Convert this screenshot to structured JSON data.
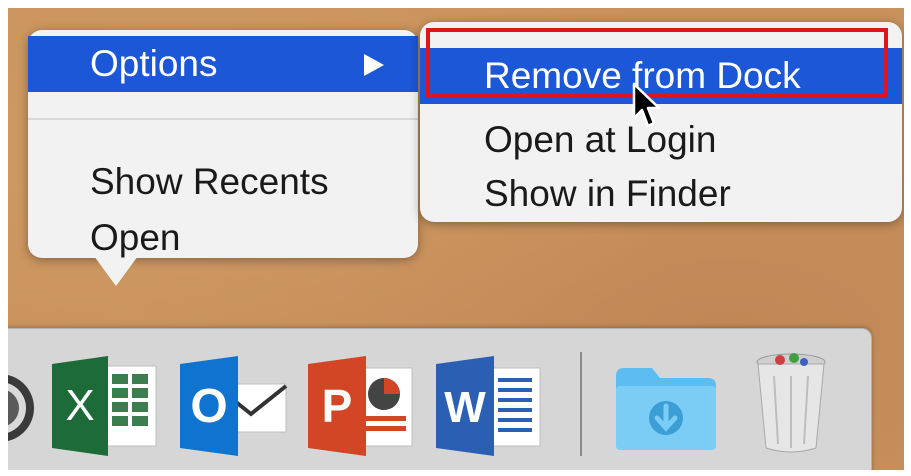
{
  "context_menu": {
    "options_label": "Options",
    "show_recents_label": "Show Recents",
    "open_label": "Open"
  },
  "submenu": {
    "remove_from_dock_label": "Remove from Dock",
    "open_at_login_label": "Open at Login",
    "show_in_finder_label": "Show in Finder"
  },
  "dock": {
    "excel_letter": "X",
    "outlook_letter": "O",
    "powerpoint_letter": "P",
    "word_letter": "W"
  },
  "colors": {
    "selection": "#1c57d8",
    "highlight_box": "#e0141c",
    "excel": "#1e6b3a",
    "outlook": "#0f74cf",
    "powerpoint": "#d24626",
    "word": "#2b5fb4",
    "folder": "#5bbdf0"
  }
}
